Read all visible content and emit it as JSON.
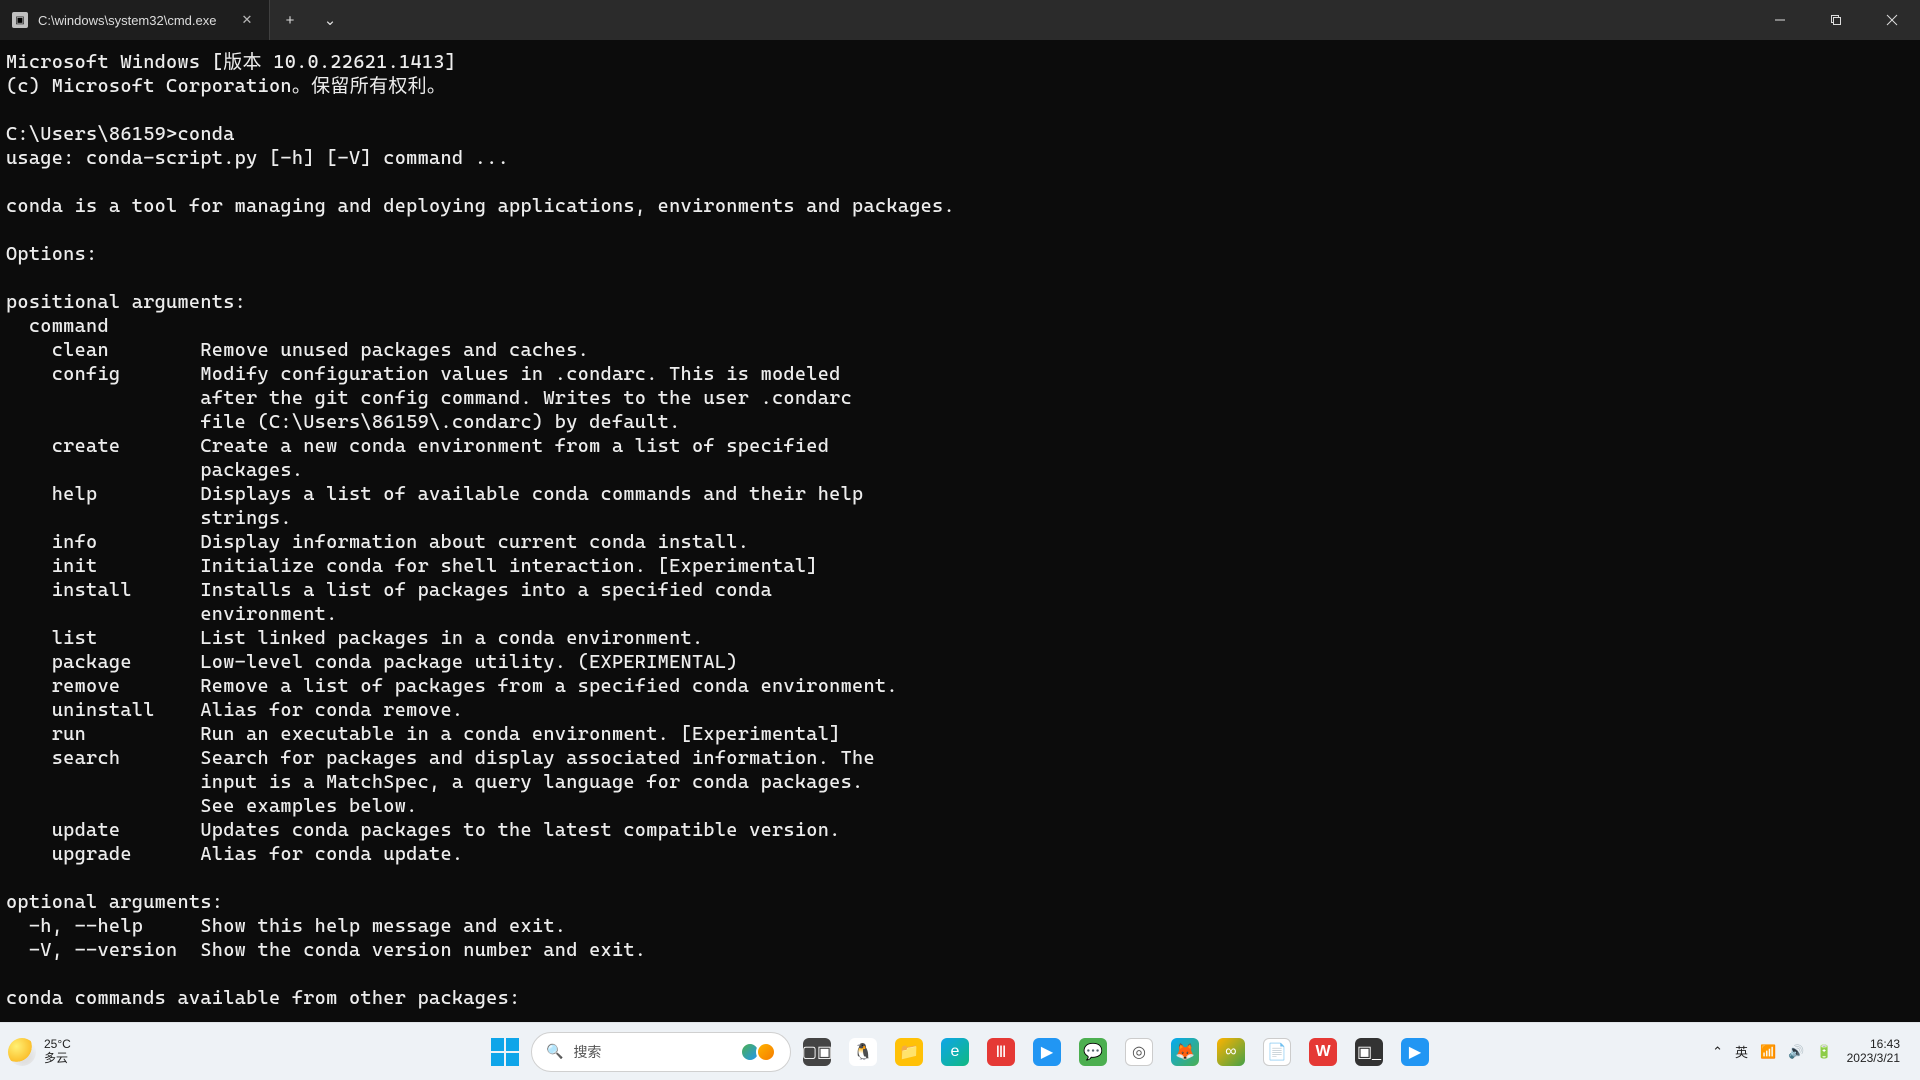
{
  "titlebar": {
    "tab_title": "C:\\windows\\system32\\cmd.exe",
    "tab_icon": "▣",
    "close_icon": "✕",
    "newtab_icon": "+",
    "dropdown_icon": "⌄"
  },
  "terminal": {
    "lines": [
      "Microsoft Windows [版本 10.0.22621.1413]",
      "(c) Microsoft Corporation。保留所有权利。",
      "",
      "C:\\Users\\86159>conda",
      "usage: conda-script.py [-h] [-V] command ...",
      "",
      "conda is a tool for managing and deploying applications, environments and packages.",
      "",
      "Options:",
      "",
      "positional arguments:",
      "  command",
      "    clean        Remove unused packages and caches.",
      "    config       Modify configuration values in .condarc. This is modeled",
      "                 after the git config command. Writes to the user .condarc",
      "                 file (C:\\Users\\86159\\.condarc) by default.",
      "    create       Create a new conda environment from a list of specified",
      "                 packages.",
      "    help         Displays a list of available conda commands and their help",
      "                 strings.",
      "    info         Display information about current conda install.",
      "    init         Initialize conda for shell interaction. [Experimental]",
      "    install      Installs a list of packages into a specified conda",
      "                 environment.",
      "    list         List linked packages in a conda environment.",
      "    package      Low-level conda package utility. (EXPERIMENTAL)",
      "    remove       Remove a list of packages from a specified conda environment.",
      "    uninstall    Alias for conda remove.",
      "    run          Run an executable in a conda environment. [Experimental]",
      "    search       Search for packages and display associated information. The",
      "                 input is a MatchSpec, a query language for conda packages.",
      "                 See examples below.",
      "    update       Updates conda packages to the latest compatible version.",
      "    upgrade      Alias for conda update.",
      "",
      "optional arguments:",
      "  -h, --help     Show this help message and exit.",
      "  -V, --version  Show the conda version number and exit.",
      "",
      "conda commands available from other packages:"
    ]
  },
  "taskbar": {
    "weather_temp": "25°C",
    "weather_desc": "多云",
    "search_placeholder": "搜索",
    "ime_lang": "英",
    "time": "16:43",
    "date": "2023/3/21",
    "tray_chevron": "⌃",
    "wifi_icon": "📶",
    "volume_icon": "🔊",
    "battery_icon": "🔋"
  },
  "icons": {
    "taskview": "▢▣",
    "penguin": "🐧",
    "folder": "📁",
    "edge": "e",
    "red_app": "Ⅲ",
    "video": "▶",
    "wechat": "💬",
    "chrome": "◎",
    "firefox": "🦊",
    "yellow_app": "∞",
    "doc_app": "📄",
    "wps": "W",
    "terminal": "▣_",
    "blue_play": "▶"
  }
}
